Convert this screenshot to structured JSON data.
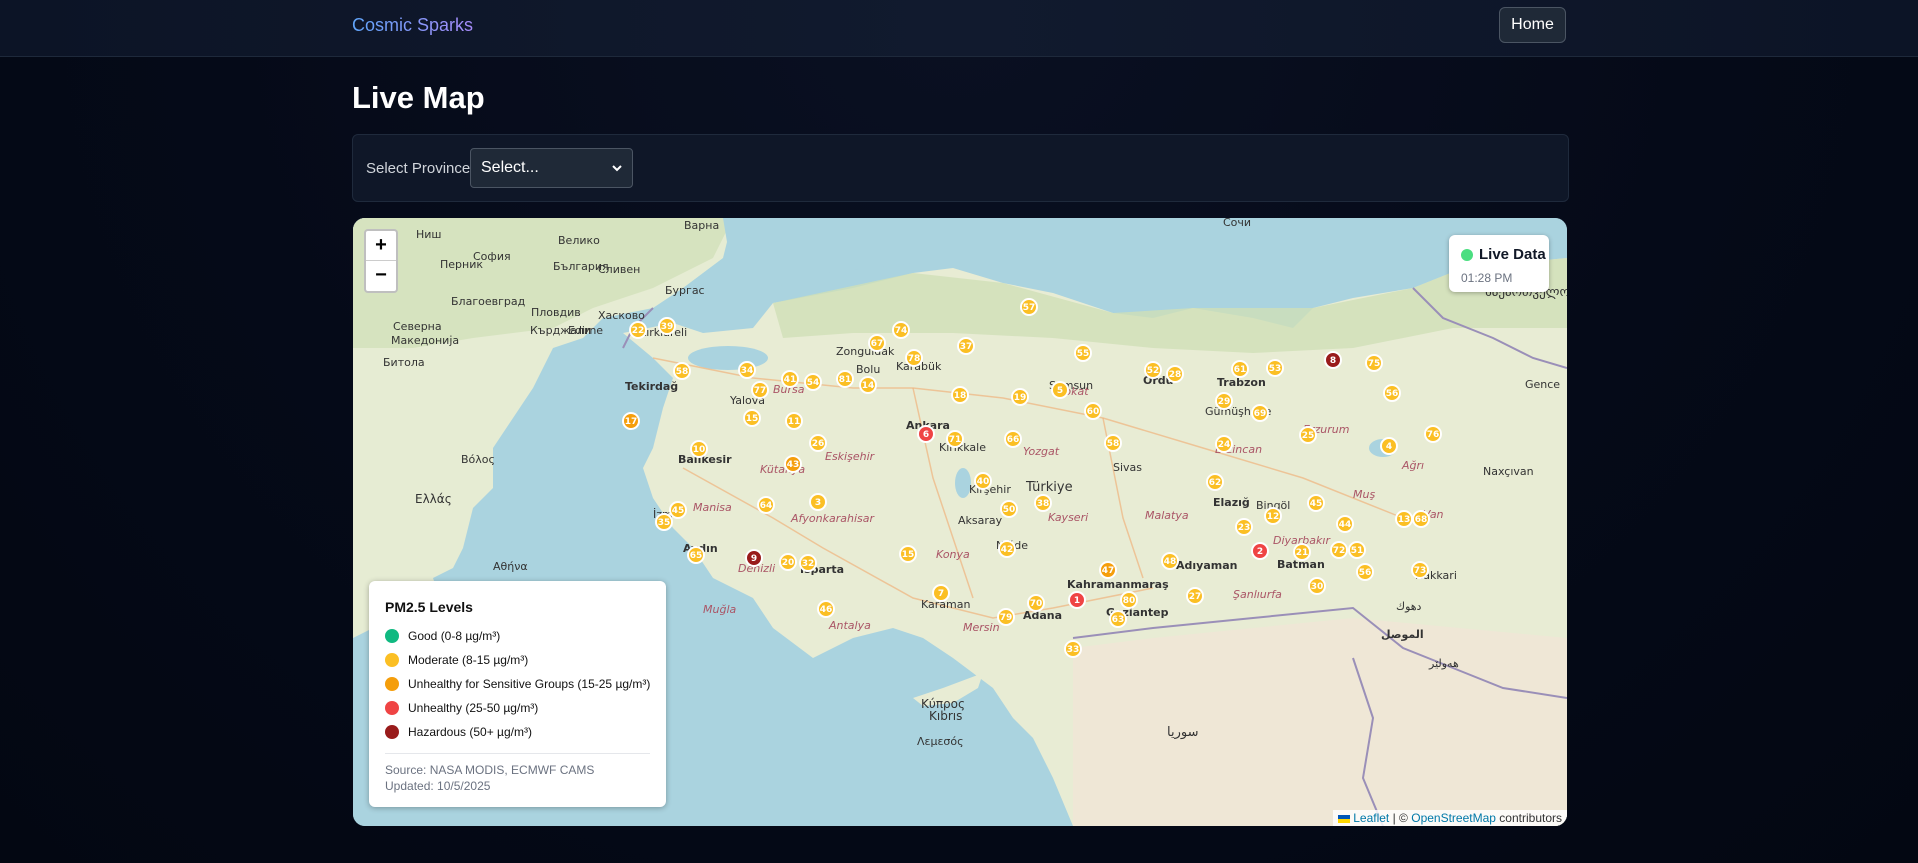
{
  "nav": {
    "brand": "Cosmic Sparks",
    "home_label": "Home"
  },
  "page": {
    "title": "Live Map"
  },
  "filter": {
    "label": "Select Province",
    "selected": "Select..."
  },
  "map": {
    "zoom_in": "+",
    "zoom_out": "−",
    "live": {
      "label": "Live Data",
      "time": "01:28 PM",
      "color": "#4ade80"
    },
    "labels": [
      "Варна",
      "София",
      "Ниш",
      "Перник",
      "Велико",
      "България",
      "Сливен",
      "Бургас",
      "Благоевград",
      "Пловдив",
      "Хасково",
      "Кърджали",
      "Edirne",
      "Kırklareli",
      "Северна",
      "Македонија",
      "Битола",
      "Tekirdağ",
      "Ελλάς",
      "Βόλος",
      "Αθήνα",
      "Balıkesir",
      "Manisa",
      "İzmir",
      "Aydın",
      "Muğla",
      "Denizli",
      "Isparta",
      "Antalya",
      "Bolu",
      "Zonguldak",
      "Karabük",
      "Ankara",
      "Kırıkkale",
      "Eskişehir",
      "Kütahya",
      "Afyonkarahisar",
      "Kırşehir",
      "Aksaray",
      "Niğde",
      "Karaman",
      "Mersin",
      "Adana",
      "Kayseri",
      "Yozgat",
      "Türkiye",
      "Sivas",
      "Ordu",
      "Trabzon",
      "Gümüşhane",
      "Erzincan",
      "Elazığ",
      "Bingöl",
      "Malatya",
      "Kahramanmaraş",
      "Gaziantep",
      "Adıyaman",
      "Batman",
      "Ağrı",
      "Hakkari",
      "Сочи",
      "საქართველო",
      "Gence",
      "Naxçıvan",
      "Κύπρος",
      "Kıbrıs",
      "Λεμεσός",
      "سوريا",
      "الموصل",
      "دهوك",
      "هەولێر",
      "Tokat",
      "Samsun",
      "Yalova",
      "Bursa",
      "Konya",
      "Erzurum",
      "Van",
      "Muş",
      "Şanlıurfa",
      "Diyarbakır"
    ],
    "stations": [
      {
        "label": "57",
        "level": "moderate"
      },
      {
        "label": "74",
        "level": "moderate"
      },
      {
        "label": "67",
        "level": "moderate"
      },
      {
        "label": "78",
        "level": "moderate"
      },
      {
        "label": "37",
        "level": "moderate"
      },
      {
        "label": "55",
        "level": "moderate"
      },
      {
        "label": "52",
        "level": "moderate"
      },
      {
        "label": "28",
        "level": "moderate"
      },
      {
        "label": "61",
        "level": "moderate"
      },
      {
        "label": "53",
        "level": "moderate"
      },
      {
        "label": "8",
        "level": "hazardous"
      },
      {
        "label": "75",
        "level": "moderate"
      },
      {
        "label": "56",
        "level": "moderate"
      },
      {
        "label": "22",
        "level": "moderate"
      },
      {
        "label": "39",
        "level": "moderate"
      },
      {
        "label": "58",
        "level": "moderate"
      },
      {
        "label": "34",
        "level": "moderate"
      },
      {
        "label": "41",
        "level": "moderate"
      },
      {
        "label": "54",
        "level": "moderate"
      },
      {
        "label": "81",
        "level": "moderate"
      },
      {
        "label": "14",
        "level": "moderate"
      },
      {
        "label": "77",
        "level": "moderate"
      },
      {
        "label": "18",
        "level": "moderate"
      },
      {
        "label": "19",
        "level": "moderate"
      },
      {
        "label": "5",
        "level": "moderate"
      },
      {
        "label": "60",
        "level": "moderate"
      },
      {
        "label": "29",
        "level": "moderate"
      },
      {
        "label": "69",
        "level": "moderate"
      },
      {
        "label": "76",
        "level": "moderate"
      },
      {
        "label": "17",
        "level": "sensitive"
      },
      {
        "label": "15",
        "level": "moderate"
      },
      {
        "label": "11",
        "level": "moderate"
      },
      {
        "label": "6",
        "level": "unhealthy"
      },
      {
        "label": "71",
        "level": "moderate"
      },
      {
        "label": "26",
        "level": "moderate"
      },
      {
        "label": "66",
        "level": "moderate"
      },
      {
        "label": "58",
        "level": "moderate"
      },
      {
        "label": "25",
        "level": "moderate"
      },
      {
        "label": "4",
        "level": "moderate"
      },
      {
        "label": "10",
        "level": "moderate"
      },
      {
        "label": "24",
        "level": "moderate"
      },
      {
        "label": "43",
        "level": "sensitive"
      },
      {
        "label": "40",
        "level": "moderate"
      },
      {
        "label": "62",
        "level": "moderate"
      },
      {
        "label": "3",
        "level": "moderate"
      },
      {
        "label": "64",
        "level": "moderate"
      },
      {
        "label": "45",
        "level": "moderate"
      },
      {
        "label": "35",
        "level": "moderate"
      },
      {
        "label": "50",
        "level": "moderate"
      },
      {
        "label": "38",
        "level": "moderate"
      },
      {
        "label": "68",
        "level": "moderate"
      },
      {
        "label": "12",
        "level": "moderate"
      },
      {
        "label": "45",
        "level": "moderate"
      },
      {
        "label": "23",
        "level": "moderate"
      },
      {
        "label": "44",
        "level": "moderate"
      },
      {
        "label": "13",
        "level": "moderate"
      },
      {
        "label": "65",
        "level": "moderate"
      },
      {
        "label": "9",
        "level": "hazardous"
      },
      {
        "label": "20",
        "level": "moderate"
      },
      {
        "label": "32",
        "level": "moderate"
      },
      {
        "label": "15",
        "level": "moderate"
      },
      {
        "label": "42",
        "level": "moderate"
      },
      {
        "label": "51",
        "level": "moderate"
      },
      {
        "label": "48",
        "level": "moderate"
      },
      {
        "label": "2",
        "level": "unhealthy"
      },
      {
        "label": "21",
        "level": "moderate"
      },
      {
        "label": "72",
        "level": "moderate"
      },
      {
        "label": "56",
        "level": "moderate"
      },
      {
        "label": "73",
        "level": "moderate"
      },
      {
        "label": "30",
        "level": "moderate"
      },
      {
        "label": "47",
        "level": "sensitive"
      },
      {
        "label": "46",
        "level": "moderate"
      },
      {
        "label": "7",
        "level": "moderate"
      },
      {
        "label": "70",
        "level": "moderate"
      },
      {
        "label": "1",
        "level": "unhealthy"
      },
      {
        "label": "80",
        "level": "moderate"
      },
      {
        "label": "27",
        "level": "moderate"
      },
      {
        "label": "63",
        "level": "moderate"
      },
      {
        "label": "79",
        "level": "moderate"
      },
      {
        "label": "33",
        "level": "moderate"
      },
      {
        "label": "31",
        "level": "moderate"
      }
    ],
    "legend": {
      "title": "PM2.5 Levels",
      "items": [
        {
          "label": "Good (0-8 µg/m³)",
          "color": "#10b981"
        },
        {
          "label": "Moderate (8-15 µg/m³)",
          "color": "#fbbf24"
        },
        {
          "label": "Unhealthy for Sensitive Groups (15-25 µg/m³)",
          "color": "#f59e0b"
        },
        {
          "label": "Unhealthy (25-50 µg/m³)",
          "color": "#ef4444"
        },
        {
          "label": "Hazardous (50+ µg/m³)",
          "color": "#991b1b"
        }
      ],
      "source": "Source: NASA MODIS, ECMWF CAMS",
      "updated": "Updated: 10/5/2025"
    },
    "attribution": {
      "leaflet": "Leaflet",
      "separator": "| ©",
      "osm": "OpenStreetMap",
      "suffix": "contributors"
    },
    "colors": {
      "moderate": "#fbbf24",
      "sensitive": "#f59e0b",
      "unhealthy": "#ef4444",
      "hazardous": "#991b1b",
      "sea": "#aad3df",
      "land": "#e8ecd4"
    }
  }
}
